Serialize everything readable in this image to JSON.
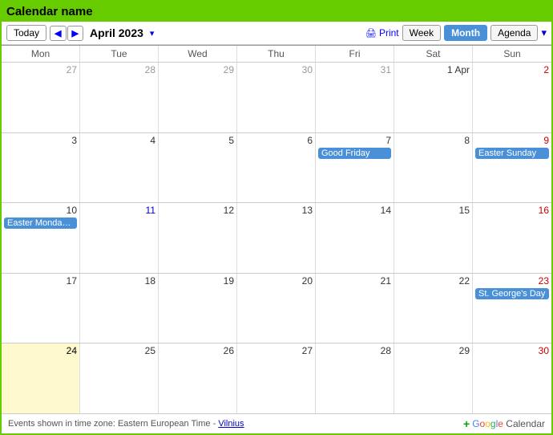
{
  "title": "Calendar name",
  "toolbar": {
    "today_label": "Today",
    "month_year": "April 2023",
    "print_label": "Print",
    "view_week": "Week",
    "view_month": "Month",
    "view_agenda": "Agenda"
  },
  "day_headers": [
    "Mon",
    "Tue",
    "Wed",
    "Thu",
    "Fri",
    "Sat",
    "Sun"
  ],
  "weeks": [
    {
      "days": [
        {
          "num": "27",
          "other": true
        },
        {
          "num": "28",
          "other": true
        },
        {
          "num": "29",
          "other": true
        },
        {
          "num": "30",
          "other": true
        },
        {
          "num": "31",
          "other": true
        },
        {
          "num": "1 Apr",
          "sunday_color": false
        },
        {
          "num": "2",
          "sunday_color": true
        }
      ]
    },
    {
      "days": [
        {
          "num": "3"
        },
        {
          "num": "4"
        },
        {
          "num": "5"
        },
        {
          "num": "6"
        },
        {
          "num": "7",
          "event": "Good Friday"
        },
        {
          "num": "8"
        },
        {
          "num": "9",
          "event": "Easter Sunday",
          "sunday_color": true
        }
      ]
    },
    {
      "days": [
        {
          "num": "10",
          "event": "Easter Monday (re"
        },
        {
          "num": "11",
          "blue": true
        },
        {
          "num": "12"
        },
        {
          "num": "13"
        },
        {
          "num": "14"
        },
        {
          "num": "15"
        },
        {
          "num": "16",
          "sunday_color": true
        }
      ]
    },
    {
      "days": [
        {
          "num": "17"
        },
        {
          "num": "18"
        },
        {
          "num": "19"
        },
        {
          "num": "20"
        },
        {
          "num": "21"
        },
        {
          "num": "22"
        },
        {
          "num": "23",
          "event": "St. George's Day",
          "sunday_color": true
        }
      ]
    },
    {
      "days": [
        {
          "num": "24",
          "today": true
        },
        {
          "num": "25"
        },
        {
          "num": "26"
        },
        {
          "num": "27"
        },
        {
          "num": "28"
        },
        {
          "num": "29"
        },
        {
          "num": "30",
          "sunday_color": true
        }
      ]
    }
  ],
  "footer": {
    "timezone_text": "Events shown in time zone: Eastern European Time - ",
    "timezone_link": "Vilnius",
    "google_calendar": "Google Calendar"
  }
}
